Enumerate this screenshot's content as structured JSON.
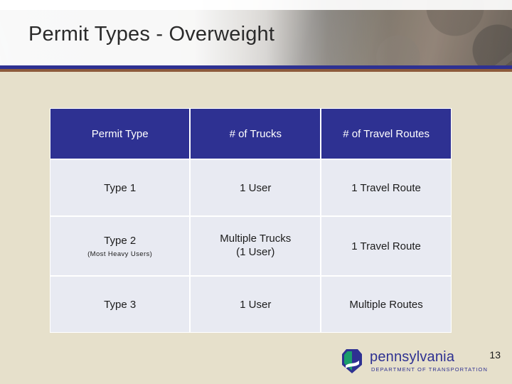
{
  "slide": {
    "title": "Permit Types - Overweight",
    "page_number": "13"
  },
  "table": {
    "headers": [
      "Permit Type",
      "# of Trucks",
      "# of Travel Routes"
    ],
    "rows": [
      {
        "type": "Type 1",
        "type_note": "",
        "trucks": "1 User",
        "trucks_line2": "",
        "routes": "1 Travel Route"
      },
      {
        "type": "Type 2",
        "type_note": "(Most Heavy Users)",
        "trucks": "Multiple Trucks",
        "trucks_line2": "(1 User)",
        "routes": "1 Travel Route"
      },
      {
        "type": "Type 3",
        "type_note": "",
        "trucks": "1 User",
        "trucks_line2": "",
        "routes": "Multiple Routes"
      }
    ]
  },
  "footer": {
    "logo_wordmark": "pennsylvania",
    "logo_department": "DEPARTMENT OF TRANSPORTATION"
  },
  "colors": {
    "header_blue": "#2e3192",
    "accent_brown": "#8d5b3c",
    "cell_bg": "#e8eaf2",
    "page_bg": "#e6e0cb"
  }
}
